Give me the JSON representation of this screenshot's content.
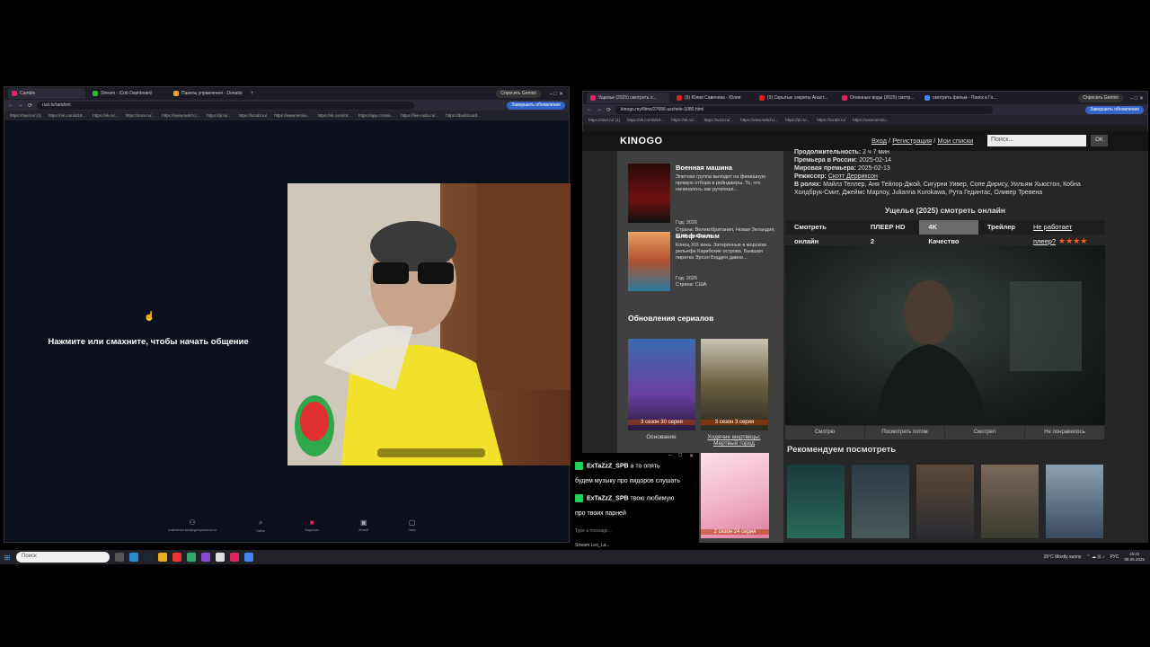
{
  "left_browser": {
    "tabs": [
      {
        "label": "Camble",
        "color": "#e0245e"
      },
      {
        "label": "Stream - iCob Dashboard",
        "color": "#2ebd3a"
      },
      {
        "label": "Панель управления - Donatio",
        "color": "#f5a623"
      }
    ],
    "url": "ruvi.tv/random",
    "gemini": "Спросить Gemini",
    "update": "Завершить обновление",
    "bookmarks": [
      "https://rawl.ru/ (1)",
      "https://vk.com/id18...",
      "https://vk.ru/...",
      "https://sora.ru/...",
      "https://www.twitch.t...",
      "https://pl.ru/...",
      "https://lozabl.ru/",
      "https://www.tenniu...",
      "https://vk.com/lot...",
      "https://app.crossa...",
      "https://live-radio.ru/...",
      "https://dashboard..."
    ],
    "prompt": "Нажмите или смахните, чтобы начать общение",
    "bottom_nav": [
      {
        "label": "изменения конфиденциальности",
        "icon": "user-icon"
      },
      {
        "label": "Найти",
        "icon": "search-icon"
      },
      {
        "label": "Видеочат",
        "icon": "video-icon",
        "active": true
      },
      {
        "label": "Живой",
        "icon": "live-icon"
      },
      {
        "label": "Чаты",
        "icon": "chat-icon"
      }
    ]
  },
  "right_browser": {
    "tabs": [
      {
        "label": "Ущелье (2025) смотреть о...",
        "color": "#e0245e"
      },
      {
        "label": "(9) Юлия Савичева - Юлия",
        "color": "#e02020"
      },
      {
        "label": "(9) Скрытые секреты Анаст...",
        "color": "#e02020"
      },
      {
        "label": "Огненные воды (2025) смотр...",
        "color": "#e0245e"
      },
      {
        "label": "смотреть фильм - Поиск в Го...",
        "color": "#4285f4"
      }
    ],
    "url": "kinogo.my/films/27656-uschele-1080.html",
    "gemini": "Спросить Gemini",
    "update": "Завершить обновление"
  },
  "site": {
    "logo": "KINOGO",
    "nav": {
      "login": "Вход",
      "register": "Регистрация",
      "lists": "Мои списки",
      "sep": "/"
    },
    "search_placeholder": "Поиск...",
    "ok": "OK",
    "side_movies": [
      {
        "title": "Военная машина",
        "desc": "Элитная группа выходит на финишную прямую отбора в рейнджеры. То, что начиналось как рутинная...",
        "year": "Год: 2026",
        "country": "Страна: Великобритания, Новая Зеландия, США, Австралия"
      },
      {
        "title": "Блеф Фильм",
        "desc": "Конец XIX века. Затерянные в морском рельефе Карибские острова. Бывшая пиратка Эрсол Бодден давно...",
        "year": "Год: 2026",
        "country": "Страна: США"
      }
    ],
    "series_title": "Обновления сериалов",
    "series": [
      {
        "name": "Основание",
        "badge": "3 сезон 30 серия"
      },
      {
        "name": "Ходячие мертвецы: Мертвый город",
        "badge": "3 сезон 3 серия"
      },
      {
        "name": "",
        "badge": "2 сезон 24 серия"
      }
    ],
    "info": {
      "duration_label": "Продолжительность:",
      "duration": "2 ч 7 мин",
      "premiere_ru_label": "Премьера в России:",
      "premiere_ru": "2025-02-14",
      "premiere_world_label": "Мировая премьера:",
      "premiere_world": "2025-02-13",
      "director_label": "Режиссер:",
      "director": "Скотт Дерриксон",
      "cast_label": "В ролях:",
      "cast": "Майлз Теллер, Аня Тейлор-Джой, Сигурни Уивер, Сопе Дирису, Уильям Хьюстон, Кобна Холдбрук-Смит, Джеймс Марлоу, Julianna Kurokawa, Рута Гединтас, Оливер Тревена"
    },
    "watch_title": "Ущелье (2025) смотреть онлайн",
    "player_tabs": [
      "Смотреть онлайн",
      "ПЛЕЕР HD 2",
      "4K Качество",
      "Трейлер",
      "Не работает плеер?"
    ],
    "rating_stars": "★★★★",
    "video_buttons": [
      "Смотрю",
      "Посмотреть потом",
      "Смотрел",
      "Не понравилось"
    ],
    "recommend_title": "Рекомендуем посмотреть"
  },
  "chat": {
    "messages": [
      {
        "user": "ExTaZzZ_SPB",
        "text": "а то опять"
      },
      {
        "text": "будем музыку про пидоров слушать"
      },
      {
        "user": "ExTaZzZ_SPB",
        "text": "твою любимую"
      },
      {
        "text": "про твоих парней"
      }
    ],
    "input_placeholder": "Type a message...",
    "stream_label": "Stream Leo_La..."
  },
  "taskbar": {
    "search": "Поиск",
    "weather": "26°C  Mostly sunny",
    "lang": "РУС",
    "time": "15:22",
    "date": "09.06.2025"
  }
}
